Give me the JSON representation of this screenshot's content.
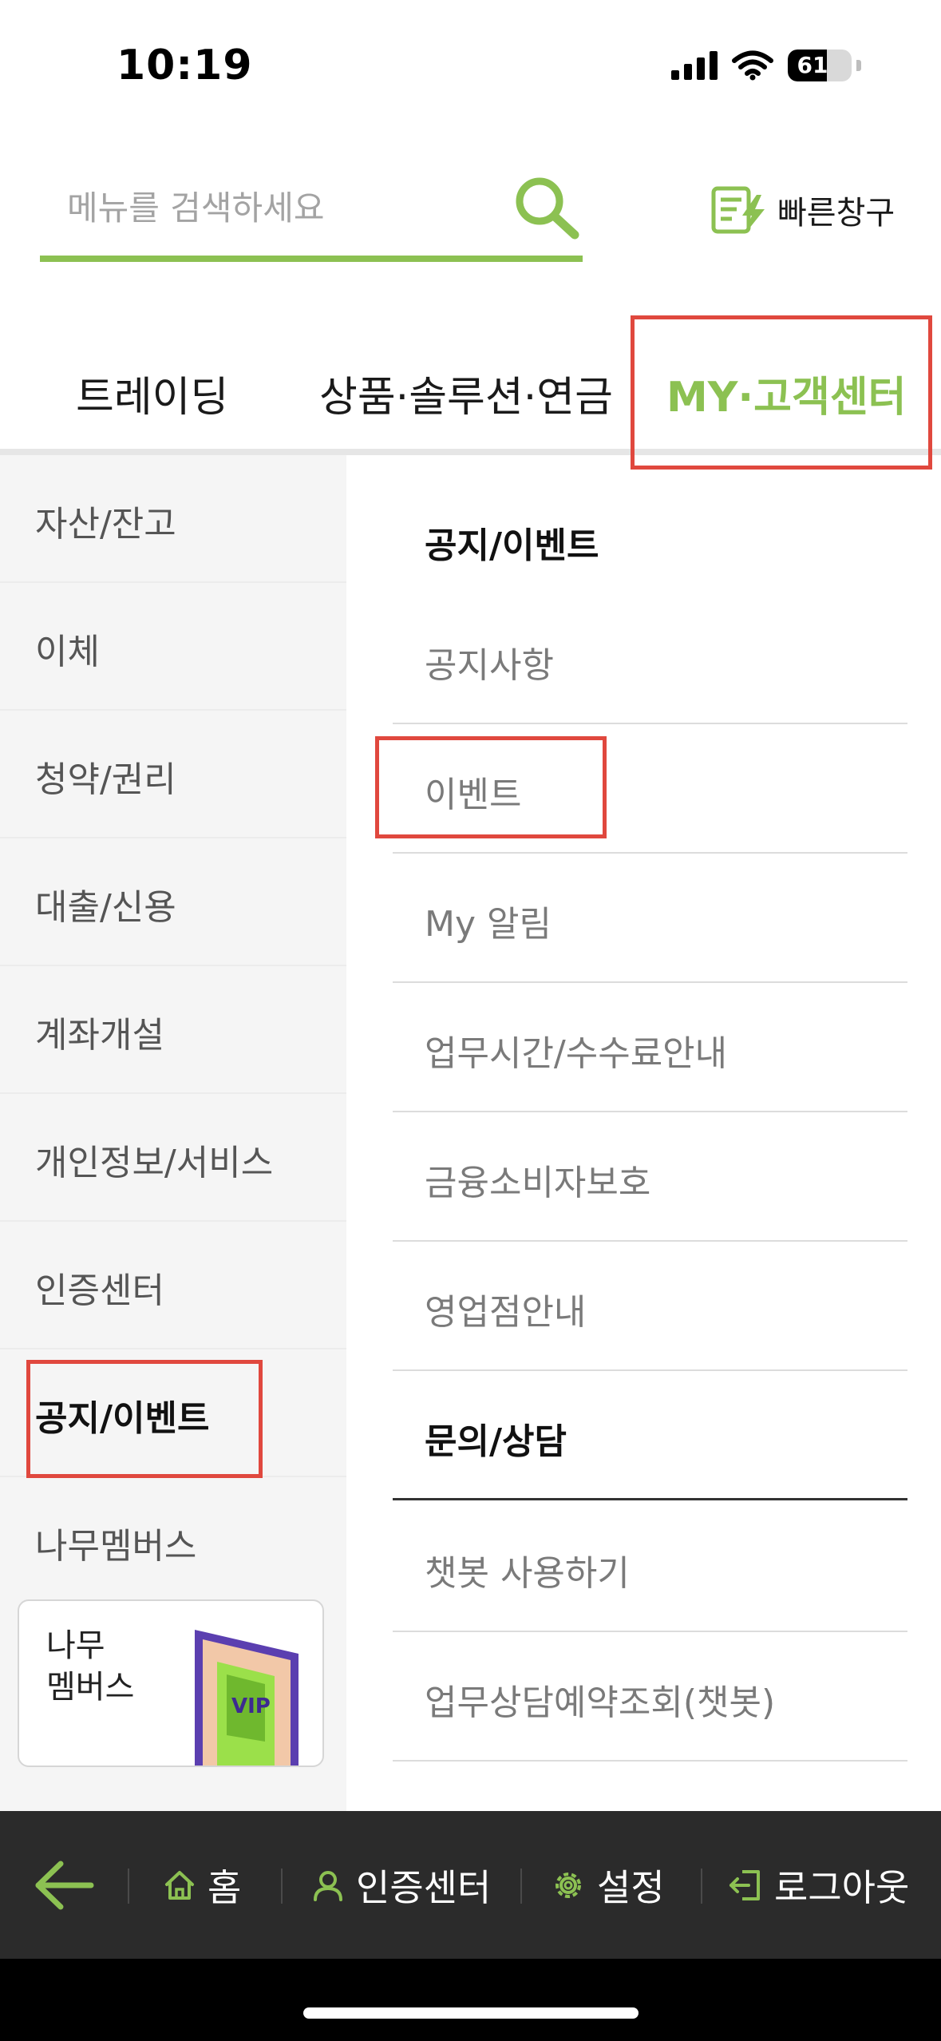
{
  "status_bar": {
    "time": "10:19",
    "battery": "61",
    "battery_level": 0.61
  },
  "search": {
    "placeholder": "메뉴를 검색하세요"
  },
  "quick_window": {
    "label": "빠른창구"
  },
  "tabs": [
    {
      "label": "트레이딩",
      "active": false
    },
    {
      "label": "상품·솔루션·연금",
      "active": false
    },
    {
      "label": "MY·고객센터",
      "active": true
    }
  ],
  "sidebar": {
    "items": [
      {
        "label": "자산/잔고",
        "active": false
      },
      {
        "label": "이체",
        "active": false
      },
      {
        "label": "청약/권리",
        "active": false
      },
      {
        "label": "대출/신용",
        "active": false
      },
      {
        "label": "계좌개설",
        "active": false
      },
      {
        "label": "개인정보/서비스",
        "active": false
      },
      {
        "label": "인증센터",
        "active": false
      },
      {
        "label": "공지/이벤트",
        "active": true
      },
      {
        "label": "나무멤버스",
        "active": false
      }
    ],
    "promo": {
      "line1": "나무",
      "line2": "멤버스",
      "badge": "VIP"
    }
  },
  "panel": {
    "items": [
      {
        "label": "공지/이벤트",
        "type": "header"
      },
      {
        "label": "공지사항",
        "type": "link"
      },
      {
        "label": "이벤트",
        "type": "link"
      },
      {
        "label": "My 알림",
        "type": "link"
      },
      {
        "label": "업무시간/수수료안내",
        "type": "link"
      },
      {
        "label": "금융소비자보호",
        "type": "link"
      },
      {
        "label": "영업점안내",
        "type": "link"
      },
      {
        "label": "문의/상담",
        "type": "header"
      },
      {
        "label": "챗봇 사용하기",
        "type": "link"
      },
      {
        "label": "업무상담예약조회(챗봇)",
        "type": "link"
      }
    ]
  },
  "bottom_nav": {
    "home": "홈",
    "auth": "인증센터",
    "settings": "설정",
    "logout": "로그아웃"
  },
  "colors": {
    "accent": "#8cc152",
    "highlight": "#e0483e",
    "nav_bg": "#2b2b2b"
  }
}
